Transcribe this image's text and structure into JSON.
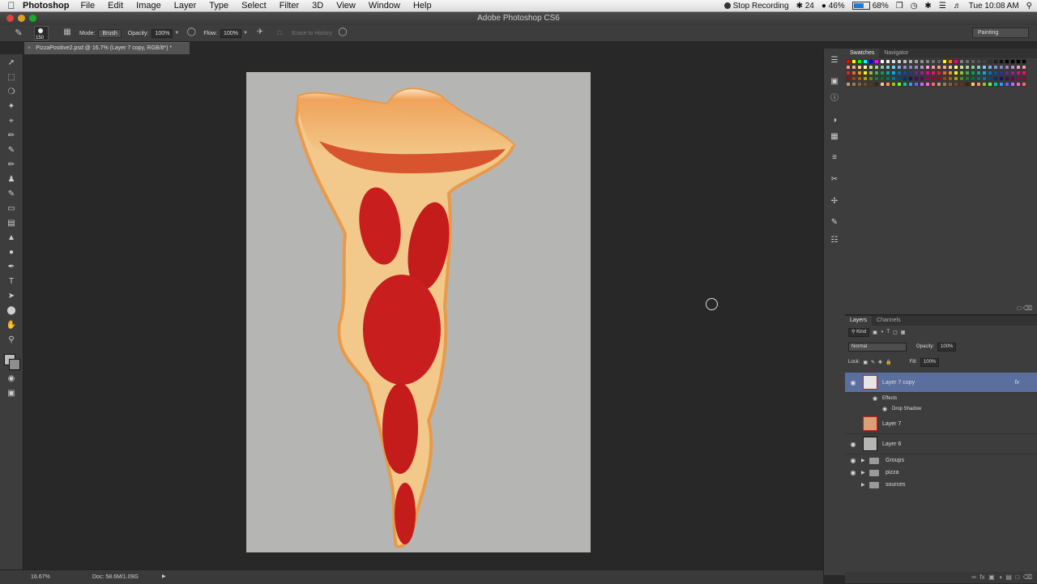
{
  "menubar": {
    "app": "Photoshop",
    "items": [
      "File",
      "Edit",
      "Image",
      "Layer",
      "Type",
      "Select",
      "Filter",
      "3D",
      "View",
      "Window",
      "Help"
    ],
    "recording": "Stop Recording",
    "status_num": "24",
    "cpu": "46%",
    "battery": "68%",
    "battery_level": 0.68,
    "clock": "Tue 10:08 AM"
  },
  "window": {
    "title": "Adobe Photoshop CS6"
  },
  "options": {
    "brush_size": "150",
    "mode_label": "Mode:",
    "mode_value": "Brush",
    "opacity_label": "Opacity:",
    "opacity_value": "100%",
    "flow_label": "Flow:",
    "flow_value": "100%",
    "erase_history": "Erase to History",
    "workspace": "Painting"
  },
  "document": {
    "tab_title": "PizzaPositive2.psd @ 16.7% (Layer 7 copy, RGB/8*) *"
  },
  "status": {
    "zoom": "16.67%",
    "doc_size": "Doc: 58.6M/1.09G"
  },
  "panels": {
    "swatches_tab": "Swatches",
    "navigator_tab": "Navigator",
    "layers_tab": "Layers",
    "channels_tab": "Channels",
    "kind_label": "Kind",
    "blend_mode": "Normal",
    "opacity_label": "Opacity:",
    "opacity_value": "100%",
    "lock_label": "Lock:",
    "fill_label": "Fill:",
    "fill_value": "100%"
  },
  "layers": [
    {
      "name": "Layer 7 copy",
      "visible": true,
      "selected": true,
      "fx": "fx",
      "effects": [
        "Effects",
        "Drop Shadow"
      ]
    },
    {
      "name": "Layer 7",
      "visible": false
    },
    {
      "name": "Layer 6",
      "visible": true
    }
  ],
  "groups": [
    {
      "name": "Groups",
      "visible": true
    },
    {
      "name": "pizza",
      "visible": true
    },
    {
      "name": "sources",
      "visible": false
    }
  ],
  "colors": {
    "selected_layer": "#5a6f9e",
    "canvas_bg": "#b5b6b3",
    "pepperoni": "#c81e1e",
    "crust": "#f2c98a"
  }
}
